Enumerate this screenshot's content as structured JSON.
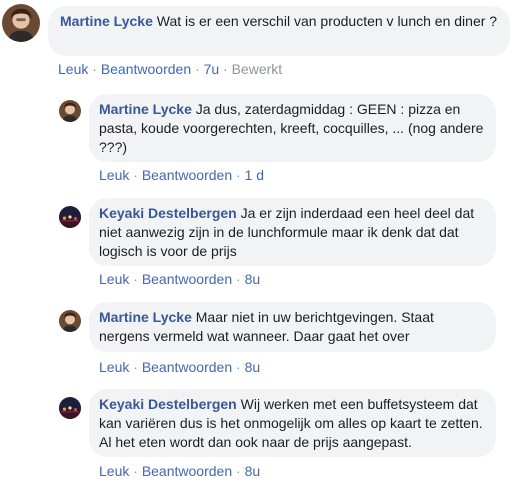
{
  "comments": [
    {
      "author": "Martine Lycke",
      "text": "Wat is er een verschil van producten v lunch en diner ?",
      "actions": {
        "like": "Leuk",
        "reply": "Beantwoorden",
        "time": "7u",
        "edited": "Bewerkt"
      },
      "avatar_icon": "profile-photo-martine"
    },
    {
      "author": "Martine Lycke",
      "text": "Ja dus, zaterdagmiddag : GEEN : pizza en pasta, koude voorgerechten, kreeft, cocquilles, ... (nog andere ???)",
      "actions": {
        "like": "Leuk",
        "reply": "Beantwoorden",
        "time": "1 d"
      },
      "avatar_icon": "profile-photo-martine"
    },
    {
      "author": "Keyaki Destelbergen",
      "text": "Ja er zijn inderdaad een heel deel dat niet aanwezig zijn in de lunchformule maar ik denk dat dat logisch is voor de prijs",
      "actions": {
        "like": "Leuk",
        "reply": "Beantwoorden",
        "time": "8u"
      },
      "avatar_icon": "profile-photo-keyaki"
    },
    {
      "author": "Martine Lycke",
      "text": "Maar niet in uw berichtgevingen. Staat nergens vermeld wat wanneer. Daar gaat het over",
      "actions": {
        "like": "Leuk",
        "reply": "Beantwoorden",
        "time": "8u"
      },
      "avatar_icon": "profile-photo-martine"
    },
    {
      "author": "Keyaki Destelbergen",
      "text": "Wij werken met een buffetsysteem dat kan variëren dus is het onmogelijk om alles op kaart te zetten. Al het eten wordt dan ook naar de prijs aangepast.",
      "actions": {
        "like": "Leuk",
        "reply": "Beantwoorden",
        "time": "8u"
      },
      "avatar_icon": "profile-photo-keyaki"
    }
  ],
  "colors": {
    "author": "#385898",
    "link": "#4267b2",
    "meta": "#90949c",
    "bubble": "#f2f3f5"
  }
}
